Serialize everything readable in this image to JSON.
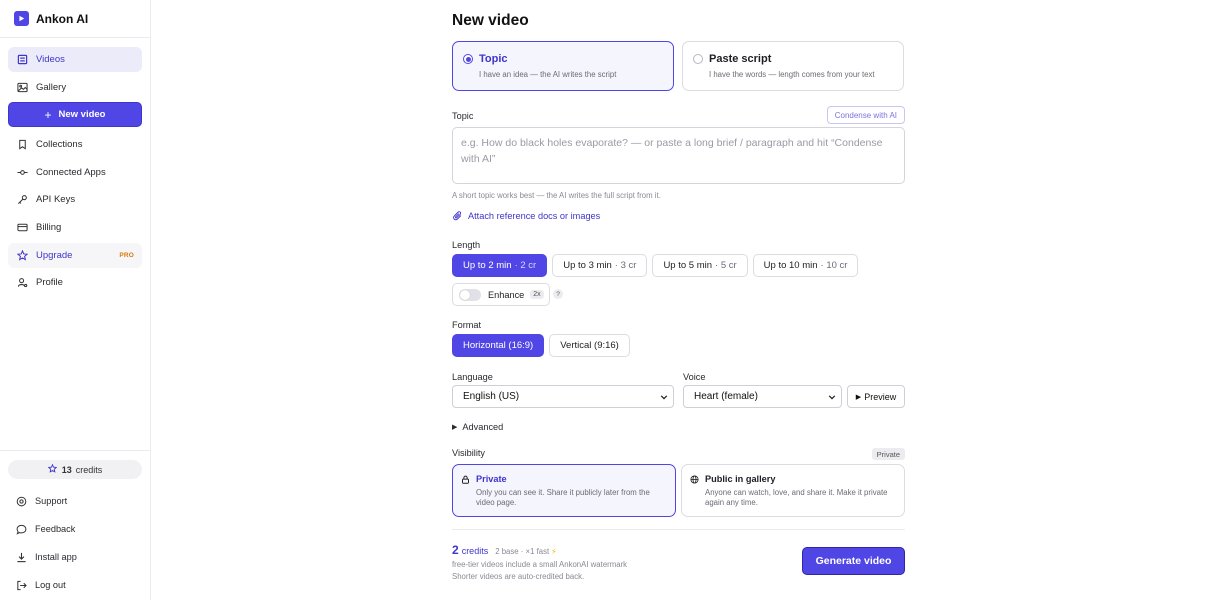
{
  "app": {
    "name": "Ankon AI"
  },
  "colors": {
    "accent": "#4f46e5",
    "pro_badge": "#d97706"
  },
  "sidebar": {
    "items": [
      {
        "label": "Videos",
        "icon": "list-icon"
      },
      {
        "label": "Gallery",
        "icon": "image-icon"
      },
      {
        "label": "Collections",
        "icon": "bookmark-icon"
      },
      {
        "label": "Connected Apps",
        "icon": "plug-icon"
      },
      {
        "label": "API Keys",
        "icon": "key-icon"
      },
      {
        "label": "Billing",
        "icon": "credit-card-icon"
      },
      {
        "label": "Upgrade",
        "icon": "star-icon",
        "badge": "PRO"
      },
      {
        "label": "Profile",
        "icon": "user-icon"
      }
    ],
    "new_video_label": "New video",
    "credits": {
      "count": "13",
      "label": "credits"
    },
    "bottom": [
      {
        "label": "Support",
        "icon": "help-icon"
      },
      {
        "label": "Feedback",
        "icon": "chat-icon"
      },
      {
        "label": "Install app",
        "icon": "download-icon"
      },
      {
        "label": "Log out",
        "icon": "logout-icon"
      }
    ]
  },
  "main": {
    "title": "New video",
    "modes": [
      {
        "label": "Topic",
        "desc": "I have an idea — the AI writes the script",
        "selected": true
      },
      {
        "label": "Paste script",
        "desc": "I have the words — length comes from your text",
        "selected": false
      }
    ],
    "topic": {
      "label": "Topic",
      "condense_label": "Condense with AI",
      "placeholder": "e.g. How do black holes evaporate?  — or paste a long brief / paragraph and hit “Condense with AI”",
      "hint": "A short topic works best — the AI writes the full script from it.",
      "attach_label": "Attach reference docs or images"
    },
    "length": {
      "label": "Length",
      "options": [
        {
          "label": "Up to 2 min",
          "cost": "· 2 cr",
          "selected": true
        },
        {
          "label": "Up to 3 min",
          "cost": "· 3 cr",
          "selected": false
        },
        {
          "label": "Up to 5 min",
          "cost": "· 5 cr",
          "selected": false
        },
        {
          "label": "Up to 10 min",
          "cost": "· 10 cr",
          "selected": false
        }
      ],
      "enhance_label": "Enhance",
      "enhance_badge": "2x",
      "help": "?"
    },
    "format": {
      "label": "Format",
      "options": [
        {
          "label": "Horizontal (16:9)",
          "selected": true
        },
        {
          "label": "Vertical (9:16)",
          "selected": false
        }
      ]
    },
    "language": {
      "label": "Language",
      "value": "English (US)"
    },
    "voice": {
      "label": "Voice",
      "value": "Heart (female)",
      "preview_label": "Preview"
    },
    "advanced_label": "Advanced",
    "visibility": {
      "label": "Visibility",
      "badge": "Private",
      "options": [
        {
          "label": "Private",
          "desc": "Only you can see it. Share it publicly later from the video page.",
          "selected": true
        },
        {
          "label": "Public in gallery",
          "desc": "Anyone can watch, love, and share it. Make it private again any time.",
          "selected": false
        }
      ]
    },
    "footer": {
      "credits_num": "2",
      "credits_unit": "credits",
      "meta": "2 base · ×1 fast",
      "note1": "free-tier videos include a small AnkonAI watermark",
      "note2": "Shorter videos are auto-credited back.",
      "generate_label": "Generate video"
    }
  }
}
